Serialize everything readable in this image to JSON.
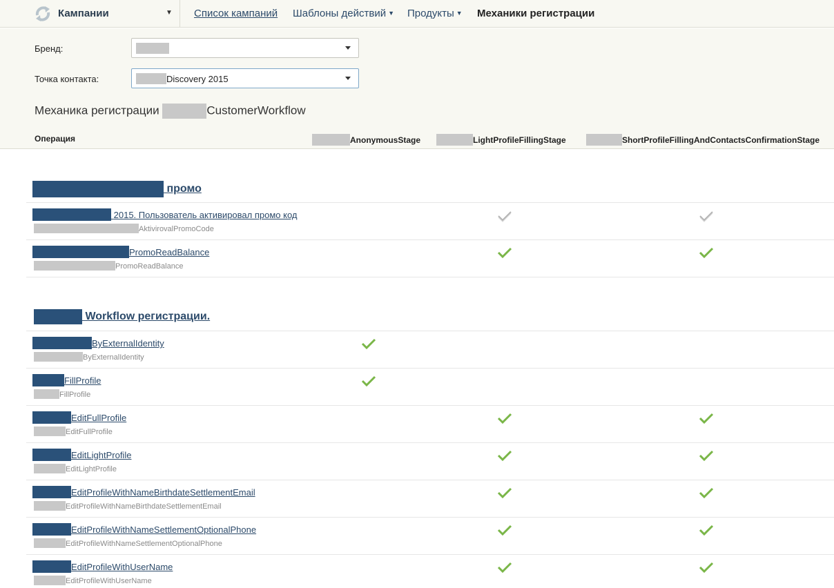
{
  "header": {
    "app_title": "Кампании",
    "nav": {
      "campaign_list": "Список кампаний",
      "action_templates": "Шаблоны действий",
      "products": "Продукты",
      "registration_mechanics": "Механики регистрации"
    }
  },
  "filters": {
    "brand_label": "Бренд:",
    "brand_value": "",
    "contact_point_label": "Точка контакта:",
    "contact_point_value": "Discovery 2015"
  },
  "mechanics_title": "Механика регистрации",
  "mechanics_name": "CustomerWorkflow",
  "columns": {
    "operation": "Операция",
    "stage1": "AnonymousStage",
    "stage2": "LightProfileFillingStage",
    "stage3": "ShortProfileFillingAndContactsConfirmationStage"
  },
  "sections": [
    {
      "title": "промо",
      "rows": [
        {
          "label": "2015. Пользователь активировал промо код",
          "sub": "AktivirovalPromoCode",
          "stages": [
            false,
            true,
            true
          ],
          "checked_style": "gray"
        },
        {
          "label": "PromoReadBalance",
          "sub": "PromoReadBalance",
          "stages": [
            false,
            true,
            true
          ],
          "checked_style": "green"
        }
      ]
    },
    {
      "title": "Workflow регистрации.",
      "rows": [
        {
          "label": "ByExternalIdentity",
          "sub": "ByExternalIdentity",
          "stages": [
            true,
            false,
            false
          ],
          "checked_style": "green"
        },
        {
          "label": "FillProfile",
          "sub": "FillProfile",
          "stages": [
            true,
            false,
            false
          ],
          "checked_style": "green"
        },
        {
          "label": "EditFullProfile",
          "sub": "EditFullProfile",
          "stages": [
            false,
            true,
            true
          ],
          "checked_style": "green"
        },
        {
          "label": "EditLightProfile",
          "sub": "EditLightProfile",
          "stages": [
            false,
            true,
            true
          ],
          "checked_style": "green"
        },
        {
          "label": "EditProfileWithNameBirthdateSettlementEmail",
          "sub": "EditProfileWithNameBirthdateSettlementEmail",
          "stages": [
            false,
            true,
            true
          ],
          "checked_style": "green"
        },
        {
          "label": "EditProfileWithNameSettlementOptionalPhone",
          "sub": "EditProfileWithNameSettlementOptionalPhone",
          "stages": [
            false,
            true,
            true
          ],
          "checked_style": "green"
        },
        {
          "label": "EditProfileWithUserName",
          "sub": "EditProfileWithUserName",
          "stages": [
            false,
            true,
            true
          ],
          "checked_style": "green"
        }
      ]
    }
  ],
  "colors": {
    "check_green": "#7ab648",
    "check_gray": "#b4b4b4",
    "link": "#2c4a6a",
    "redaction_dark": "#2a5179",
    "redaction_light": "#c8c8c8"
  }
}
